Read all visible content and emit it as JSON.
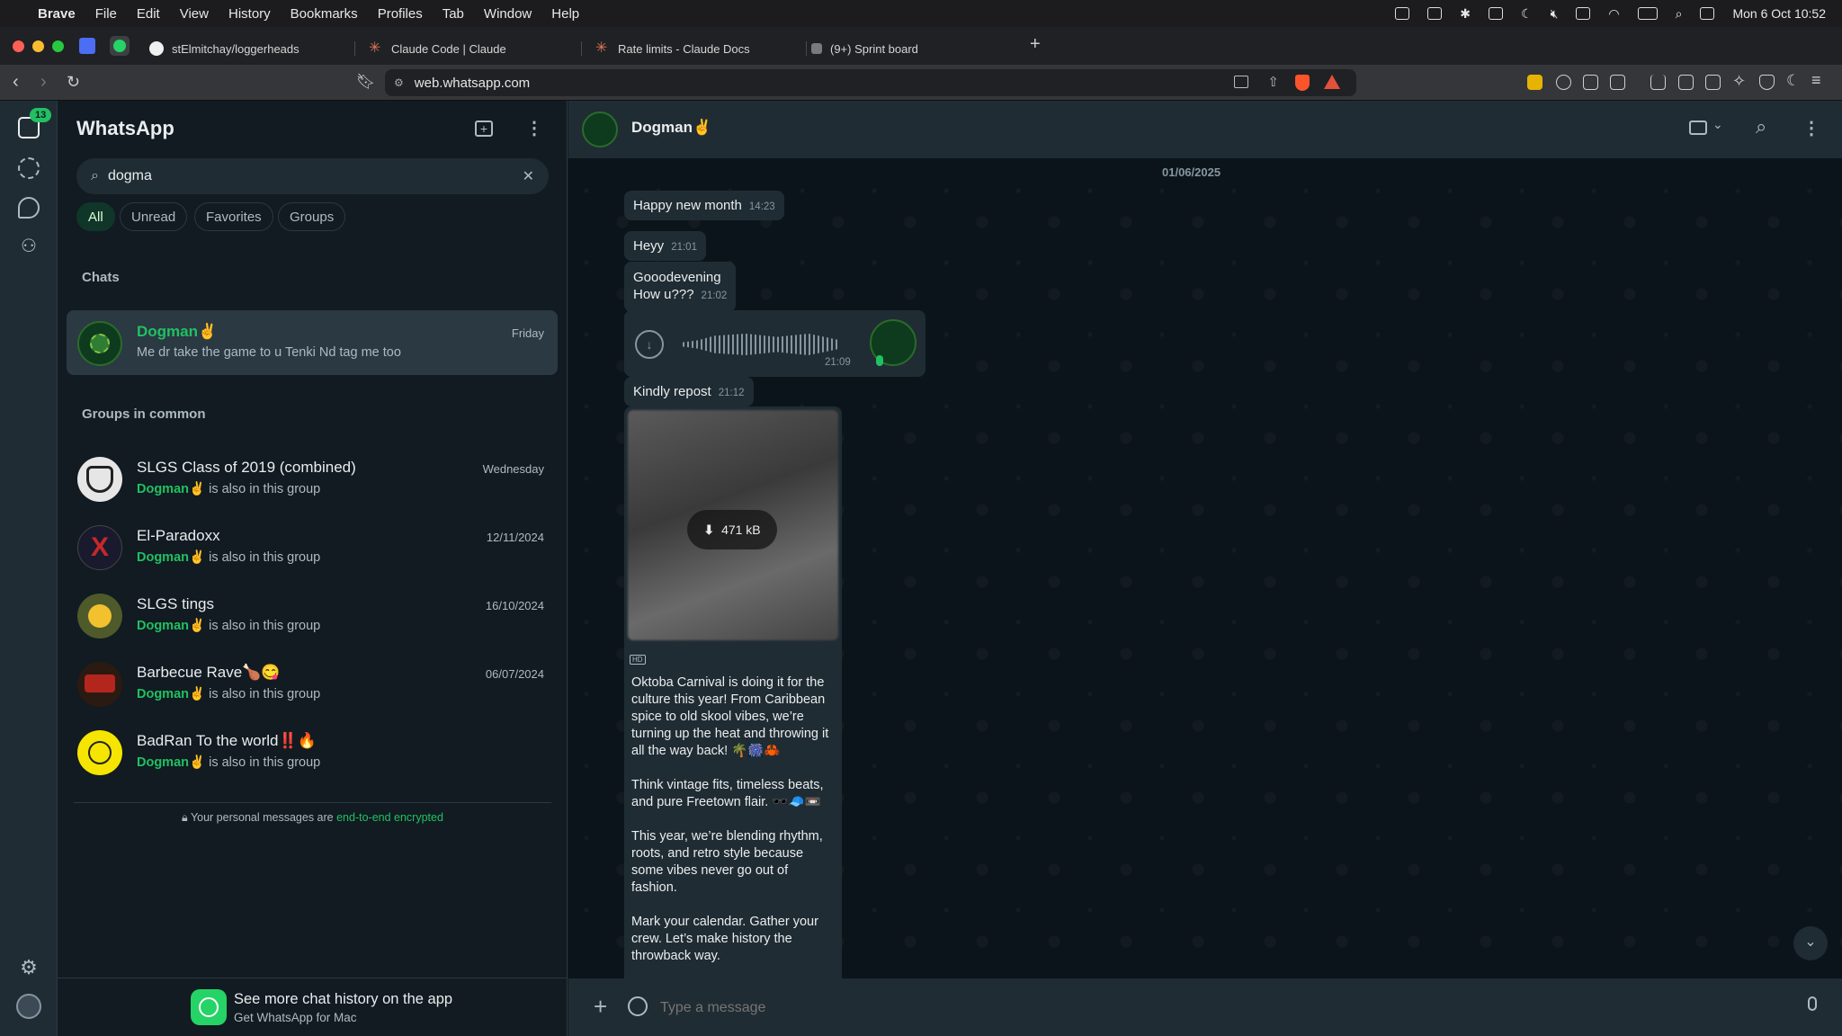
{
  "menubar": {
    "app": "Brave",
    "items": [
      "File",
      "Edit",
      "View",
      "History",
      "Bookmarks",
      "Profiles",
      "Tab",
      "Window",
      "Help"
    ],
    "datetime": "Mon 6 Oct  10:52"
  },
  "tabs": [
    {
      "title": "stElmitchay/loggerheads"
    },
    {
      "title": "Claude Code | Claude"
    },
    {
      "title": "Rate limits - Claude Docs"
    },
    {
      "title": "(9+) Sprint board"
    }
  ],
  "address": {
    "url": "web.whatsapp.com"
  },
  "rail": {
    "chats_badge": "13"
  },
  "sidebar": {
    "title": "WhatsApp",
    "search_value": "dogma",
    "filters": [
      "All",
      "Unread",
      "Favorites",
      "Groups"
    ],
    "chats_header": "Chats",
    "chat": {
      "name": "Dogman✌️",
      "last": "Me dr take the game to u Tenki  Nd tag me too",
      "date": "Friday"
    },
    "groups_header": "Groups in common",
    "groups": [
      {
        "name": "SLGS Class of 2019 (combined)",
        "member": "Dogman✌️",
        "suffix": "is also in this group",
        "date": "Wednesday"
      },
      {
        "name": "El-Paradoxx",
        "member": "Dogman✌️",
        "suffix": "is also in this group",
        "date": "12/11/2024"
      },
      {
        "name": "SLGS tings",
        "member": "Dogman✌️",
        "suffix": "is also in this group",
        "date": "16/10/2024"
      },
      {
        "name": "Barbecue Rave🍗😋",
        "member": "Dogman✌️",
        "suffix": "is also in this group",
        "date": "06/07/2024"
      },
      {
        "name": "BadRan To the world‼️🔥",
        "member": "Dogman✌️",
        "suffix": "is also in this group",
        "date": ""
      }
    ],
    "encryption_prefix": "Your personal messages are ",
    "encryption_link": "end-to-end encrypted",
    "promo_title": "See more chat history on the app",
    "promo_sub": "Get WhatsApp for Mac"
  },
  "chat": {
    "contact": "Dogman✌️",
    "date_label": "01/06/2025",
    "messages": [
      {
        "text": "Happy new month",
        "time": "14:23"
      },
      {
        "text": "Heyy",
        "time": "21:01"
      },
      {
        "line1": "Gooodevening",
        "line2": "How u???",
        "time": "21:02"
      },
      {
        "voice_time": "21:09"
      },
      {
        "text": "Kindly repost",
        "time": "21:12"
      }
    ],
    "image_size": "471 kB",
    "hd_label": "HD",
    "caption": [
      "Oktoba Carnival is doing it for the culture this year! From Caribbean spice to old skool vibes, we’re turning up the heat and throwing it all the way back! 🌴🎆🦀",
      "Think vintage fits, timeless beats, and pure Freetown flair. 🕶️🧢📼",
      "This year, we’re blending rhythm, roots, and retro style because some vibes never go out of fashion.",
      "Mark your calendar. Gather your crew. Let’s make history the throwback way."
    ],
    "composer_placeholder": "Type a message"
  }
}
